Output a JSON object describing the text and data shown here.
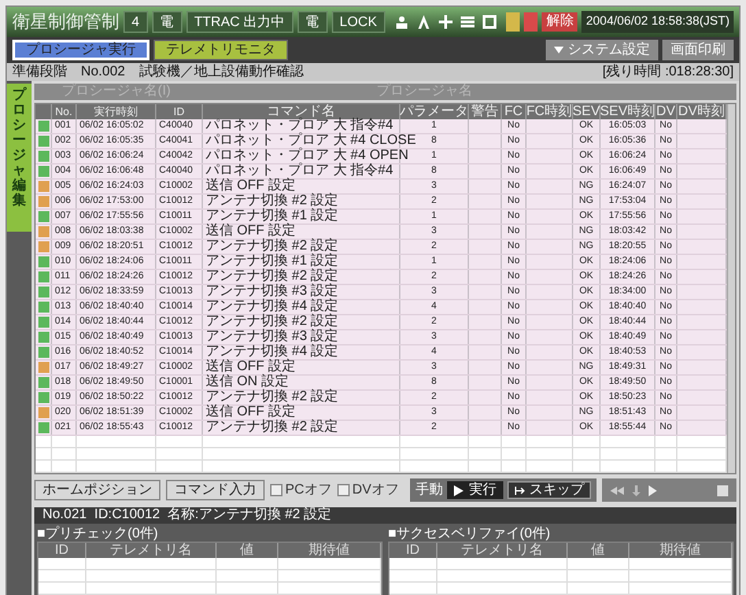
{
  "title_bar": {
    "title": "衛星制御管制",
    "indicators": [
      "4",
      "電",
      "TTRAC 出力中",
      "電",
      "LOCK"
    ],
    "alarms": [
      {
        "color": "#d4b84a"
      },
      {
        "color": "#d84a4a"
      }
    ],
    "release_button": "解除",
    "datetime": "2004/06/02 18:58:38(JST)"
  },
  "tabs": [
    {
      "label": "プロシージャ実行",
      "selected": true,
      "color": "#5b7fd4"
    },
    {
      "label": "テレメトリモニタ",
      "selected": false,
      "color": "#a8c040"
    }
  ],
  "top_buttons": [
    "システム設定",
    "画面印刷"
  ],
  "info": {
    "phase": "準備段階",
    "number": "No.002",
    "name": "試験機／地上設備動作確認",
    "remaining": "[残り時間 :018:28:30]"
  },
  "side_tab": "プロシージャ編集",
  "procedure_header": [
    "プロシージャ名(I)",
    "プロシージャ名"
  ],
  "table": {
    "columns": [
      "No.",
      "実行時刻",
      "ID",
      "コマンド名",
      "パラメータ",
      "警告",
      "FC",
      "FC時刻",
      "SEV",
      "SEV時刻",
      "DV",
      "DV時刻"
    ],
    "rows": [
      {
        "color": "#5cb85c",
        "no": "001",
        "time": "06/02 16:05:02",
        "id": "C40040",
        "command": "パロネット・プロア 大 指令#4",
        "param": "1",
        "fc": "No",
        "sev": "OK",
        "sev_time": "16:05:03",
        "dv": "No"
      },
      {
        "color": "#5cb85c",
        "no": "002",
        "time": "06/02 16:05:35",
        "id": "C40041",
        "command": "パロネット・プロア 大 #4 CLOSE",
        "param": "8",
        "fc": "No",
        "sev": "OK",
        "sev_time": "16:05:36",
        "dv": "No"
      },
      {
        "color": "#5cb85c",
        "no": "003",
        "time": "06/02 16:06:24",
        "id": "C40042",
        "command": "パロネット・プロア 大 #4 OPEN",
        "param": "1",
        "fc": "No",
        "sev": "OK",
        "sev_time": "16:06:24",
        "dv": "No"
      },
      {
        "color": "#5cb85c",
        "no": "004",
        "time": "06/02 16:06:48",
        "id": "C40040",
        "command": "パロネット・プロア 大 指令#4",
        "param": "8",
        "fc": "No",
        "sev": "OK",
        "sev_time": "16:06:49",
        "dv": "No"
      },
      {
        "color": "#e0a050",
        "no": "005",
        "time": "06/02 16:24:03",
        "id": "C10002",
        "command": "送信 OFF 設定",
        "param": "3",
        "fc": "No",
        "sev": "NG",
        "sev_time": "16:24:07",
        "dv": "No"
      },
      {
        "color": "#e0a050",
        "no": "006",
        "time": "06/02 17:53:00",
        "id": "C10012",
        "command": "アンテナ切換 #2 設定",
        "param": "2",
        "fc": "No",
        "sev": "NG",
        "sev_time": "17:53:04",
        "dv": "No"
      },
      {
        "color": "#5cb85c",
        "no": "007",
        "time": "06/02 17:55:56",
        "id": "C10011",
        "command": "アンテナ切換 #1 設定",
        "param": "1",
        "fc": "No",
        "sev": "OK",
        "sev_time": "17:55:56",
        "dv": "No"
      },
      {
        "color": "#e0a050",
        "no": "008",
        "time": "06/02 18:03:38",
        "id": "C10002",
        "command": "送信 OFF 設定",
        "param": "3",
        "fc": "No",
        "sev": "NG",
        "sev_time": "18:03:42",
        "dv": "No"
      },
      {
        "color": "#e0a050",
        "no": "009",
        "time": "06/02 18:20:51",
        "id": "C10012",
        "command": "アンテナ切換 #2 設定",
        "param": "2",
        "fc": "No",
        "sev": "NG",
        "sev_time": "18:20:55",
        "dv": "No"
      },
      {
        "color": "#5cb85c",
        "no": "010",
        "time": "06/02 18:24:06",
        "id": "C10011",
        "command": "アンテナ切換 #1 設定",
        "param": "1",
        "fc": "No",
        "sev": "OK",
        "sev_time": "18:24:06",
        "dv": "No"
      },
      {
        "color": "#5cb85c",
        "no": "011",
        "time": "06/02 18:24:26",
        "id": "C10012",
        "command": "アンテナ切換 #2 設定",
        "param": "2",
        "fc": "No",
        "sev": "OK",
        "sev_time": "18:24:26",
        "dv": "No"
      },
      {
        "color": "#5cb85c",
        "no": "012",
        "time": "06/02 18:33:59",
        "id": "C10013",
        "command": "アンテナ切換 #3 設定",
        "param": "3",
        "fc": "No",
        "sev": "OK",
        "sev_time": "18:34:00",
        "dv": "No"
      },
      {
        "color": "#5cb85c",
        "no": "013",
        "time": "06/02 18:40:40",
        "id": "C10014",
        "command": "アンテナ切換 #4 設定",
        "param": "4",
        "fc": "No",
        "sev": "OK",
        "sev_time": "18:40:40",
        "dv": "No"
      },
      {
        "color": "#5cb85c",
        "no": "014",
        "time": "06/02 18:40:44",
        "id": "C10012",
        "command": "アンテナ切換 #2 設定",
        "param": "2",
        "fc": "No",
        "sev": "OK",
        "sev_time": "18:40:44",
        "dv": "No"
      },
      {
        "color": "#5cb85c",
        "no": "015",
        "time": "06/02 18:40:49",
        "id": "C10013",
        "command": "アンテナ切換 #3 設定",
        "param": "3",
        "fc": "No",
        "sev": "OK",
        "sev_time": "18:40:49",
        "dv": "No"
      },
      {
        "color": "#5cb85c",
        "no": "016",
        "time": "06/02 18:40:52",
        "id": "C10014",
        "command": "アンテナ切換 #4 設定",
        "param": "4",
        "fc": "No",
        "sev": "OK",
        "sev_time": "18:40:53",
        "dv": "No"
      },
      {
        "color": "#e0a050",
        "no": "017",
        "time": "06/02 18:49:27",
        "id": "C10002",
        "command": "送信 OFF 設定",
        "param": "3",
        "fc": "No",
        "sev": "NG",
        "sev_time": "18:49:31",
        "dv": "No"
      },
      {
        "color": "#5cb85c",
        "no": "018",
        "time": "06/02 18:49:50",
        "id": "C10001",
        "command": "送信 ON 設定",
        "param": "8",
        "fc": "No",
        "sev": "OK",
        "sev_time": "18:49:50",
        "dv": "No"
      },
      {
        "color": "#5cb85c",
        "no": "019",
        "time": "06/02 18:50:22",
        "id": "C10012",
        "command": "アンテナ切換 #2 設定",
        "param": "2",
        "fc": "No",
        "sev": "OK",
        "sev_time": "18:50:23",
        "dv": "No"
      },
      {
        "color": "#e0a050",
        "no": "020",
        "time": "06/02 18:51:39",
        "id": "C10002",
        "command": "送信 OFF 設定",
        "param": "3",
        "fc": "No",
        "sev": "NG",
        "sev_time": "18:51:43",
        "dv": "No"
      },
      {
        "color": "#5cb85c",
        "no": "021",
        "time": "06/02 18:55:43",
        "id": "C10012",
        "command": "アンテナ切換 #2 設定",
        "param": "2",
        "fc": "No",
        "sev": "OK",
        "sev_time": "18:55:44",
        "dv": "No"
      }
    ]
  },
  "controls": {
    "buttons": [
      "ホームポジション",
      "コマンド入力"
    ],
    "checkboxes": [
      {
        "label": "PCオフ",
        "checked": false
      },
      {
        "label": "DVオフ",
        "checked": false
      }
    ],
    "mode": "手動",
    "run": "実行",
    "skip": "スキップ"
  },
  "detail_bar": "No.021  ID:C10012  名称:アンテナ切換 #2 設定",
  "panels": [
    {
      "title": "■プリチェック(0件)",
      "columns": [
        "ID",
        "テレメトリ名",
        "値",
        "期待値"
      ]
    },
    {
      "title": "■サクセスベリファイ(0件)",
      "columns": [
        "ID",
        "テレメトリ名",
        "値",
        "期待値"
      ]
    }
  ]
}
